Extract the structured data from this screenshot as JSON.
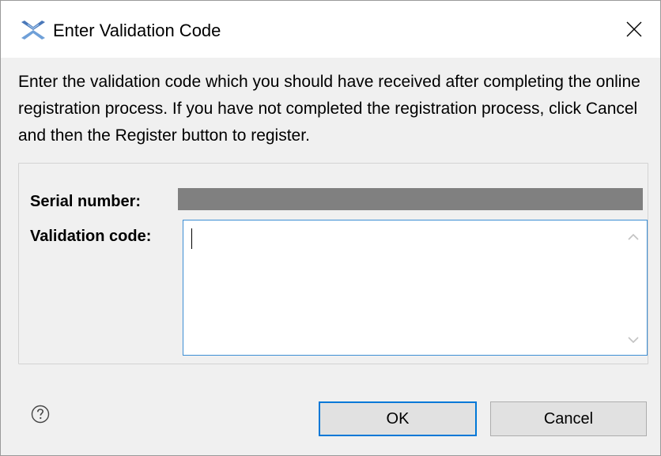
{
  "window": {
    "title": "Enter Validation Code",
    "app_icon": "eclipse-app-icon",
    "close_icon": "close-icon"
  },
  "intro_text": "Enter the validation code which you should have received after completing the online registration process. If you have not completed the registration process, click Cancel and then the Register button to register.",
  "form": {
    "serial_label": "Serial number:",
    "serial_value": "",
    "serial_value_redacted": true,
    "validation_label": "Validation code:",
    "validation_value": ""
  },
  "footer": {
    "help_icon": "help-icon",
    "ok_label": "OK",
    "cancel_label": "Cancel"
  },
  "colors": {
    "focus_accent": "#0078d7",
    "field_border": "#3d8ed4",
    "redaction": "#808080",
    "dialog_bg": "#f0f0f0"
  }
}
